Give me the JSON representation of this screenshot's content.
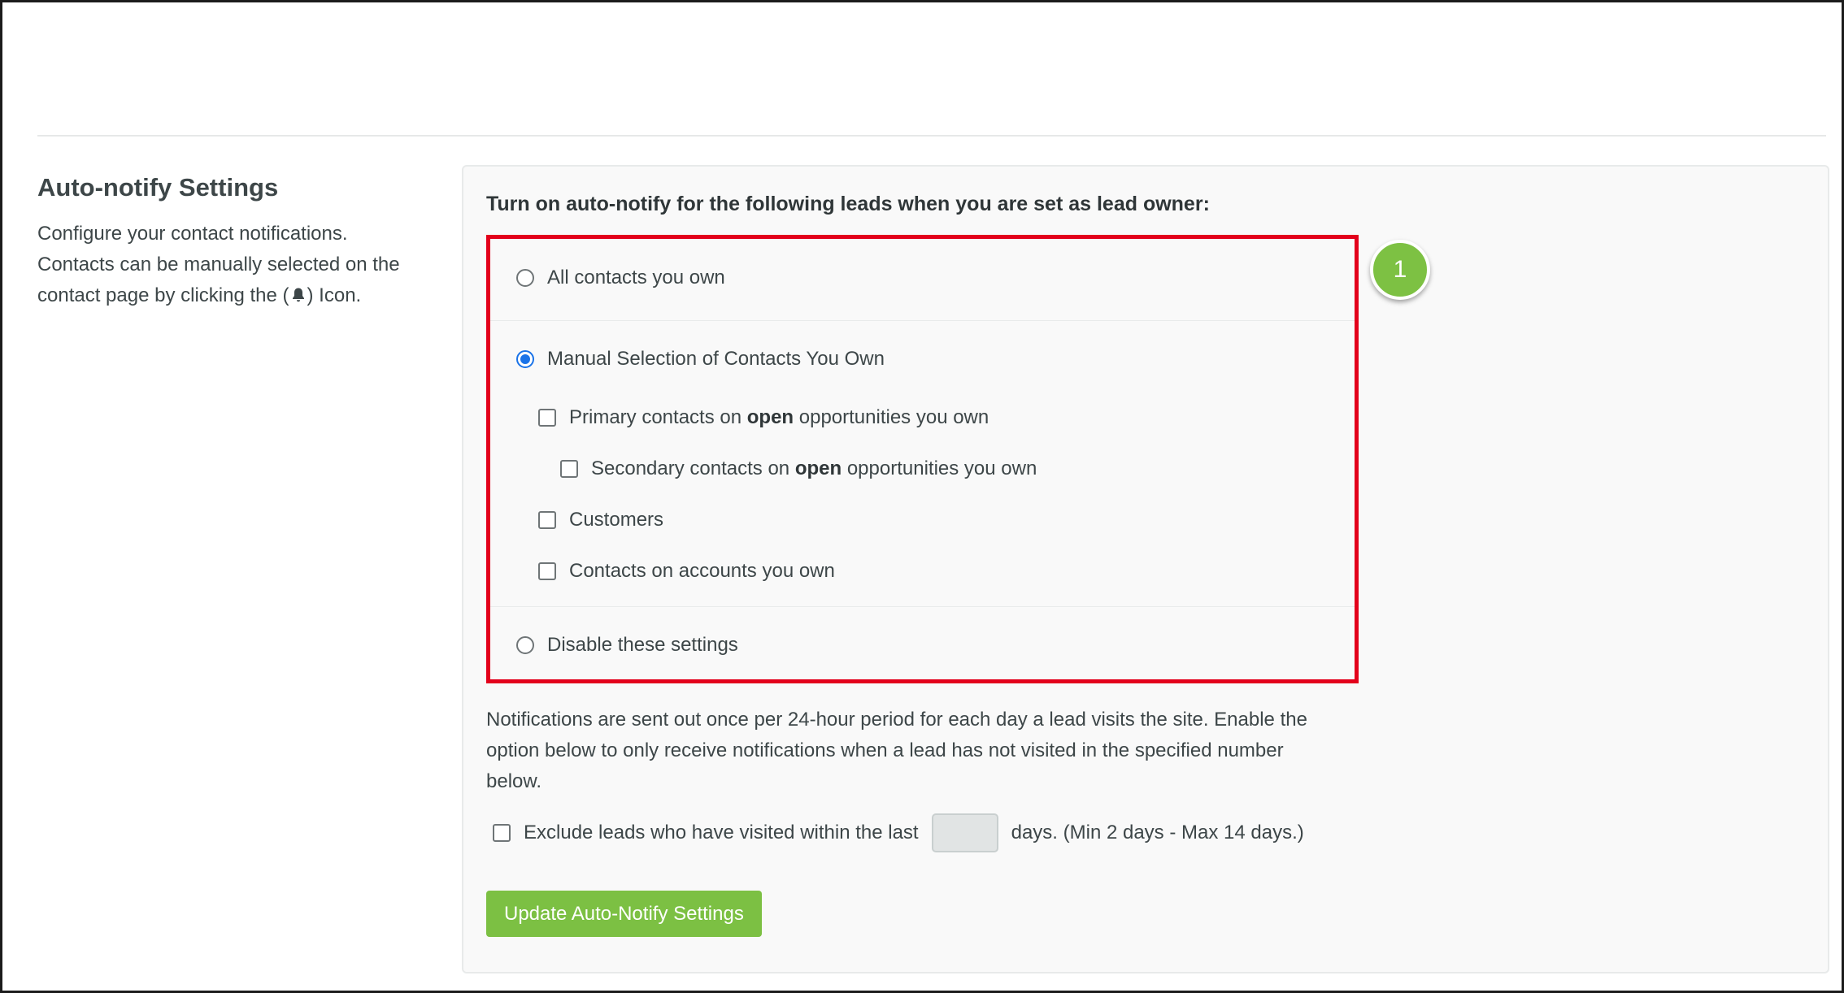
{
  "section": {
    "title": "Auto-notify Settings",
    "desc_part1": "Configure your contact notifications. Contacts can be manually selected on the contact page by clicking the (",
    "desc_icon": "bell-icon",
    "desc_part2": ") Icon."
  },
  "panel": {
    "heading": "Turn on auto-notify for the following leads when you are set as lead owner:",
    "options": {
      "all_contacts": "All contacts you own",
      "manual_selection": "Manual Selection of Contacts You Own",
      "disable": "Disable these settings"
    },
    "selected_option": "manual_selection",
    "checkboxes": {
      "primary_pre": "Primary contacts on ",
      "primary_bold": "open",
      "primary_post": " opportunities you own",
      "secondary_pre": "Secondary contacts on ",
      "secondary_bold": "open",
      "secondary_post": " opportunities you own",
      "customers": "Customers",
      "accounts": "Contacts on accounts you own"
    },
    "step_badge": "1",
    "notice": "Notifications are sent out once per 24-hour period for each day a lead visits the site. Enable the option below to only receive notifications when a lead has not visited in the specified number below.",
    "exclude": {
      "label_before": "Exclude leads who have visited within the last",
      "days_value": "",
      "label_after": "days. (Min 2 days - Max 14 days.)"
    },
    "update_button": "Update Auto-Notify Settings"
  },
  "colors": {
    "highlight": "#e3001b",
    "accent_green": "#7cc043",
    "radio_selected": "#1a73e8"
  }
}
